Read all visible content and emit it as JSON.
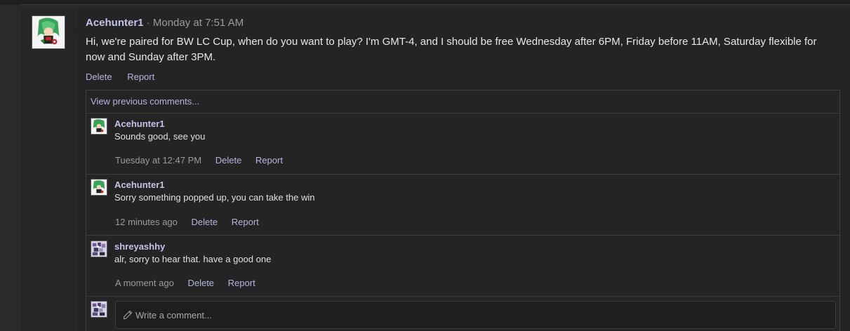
{
  "post": {
    "username": "Acehunter1",
    "separator": "·",
    "timestamp": "Monday at 7:51 AM",
    "body": "Hi, we're paired for BW LC Cup, when do you want to play? I'm GMT-4, and I should be free Wednesday after 6PM, Friday before 11AM, Saturday flexible for now and Sunday after 3PM.",
    "actions": {
      "delete": "Delete",
      "report": "Report"
    },
    "avatar_icon": "trainer-avatar-icon"
  },
  "comments_section": {
    "view_previous": "View previous comments...",
    "comments": [
      {
        "username": "Acehunter1",
        "text": "Sounds good, see you",
        "time": "Tuesday at 12:47 PM",
        "delete": "Delete",
        "report": "Report",
        "avatar_icon": "trainer-avatar-icon"
      },
      {
        "username": "Acehunter1",
        "text": "Sorry something popped up, you can take the win",
        "time": "12 minutes ago",
        "delete": "Delete",
        "report": "Report",
        "avatar_icon": "trainer-avatar-icon"
      },
      {
        "username": "shreyashhy",
        "text": "alr, sorry to hear that. have a good one",
        "time": "A moment ago",
        "delete": "Delete",
        "report": "Report",
        "avatar_icon": "pixel-avatar-icon"
      }
    ],
    "input": {
      "placeholder": "Write a comment..."
    }
  },
  "colors": {
    "background": "#2a2a2a",
    "panel": "#242424",
    "username": "#c3c3e8",
    "link": "#b5b5df",
    "muted": "#9b9b9b",
    "border": "#3e3e3e"
  }
}
